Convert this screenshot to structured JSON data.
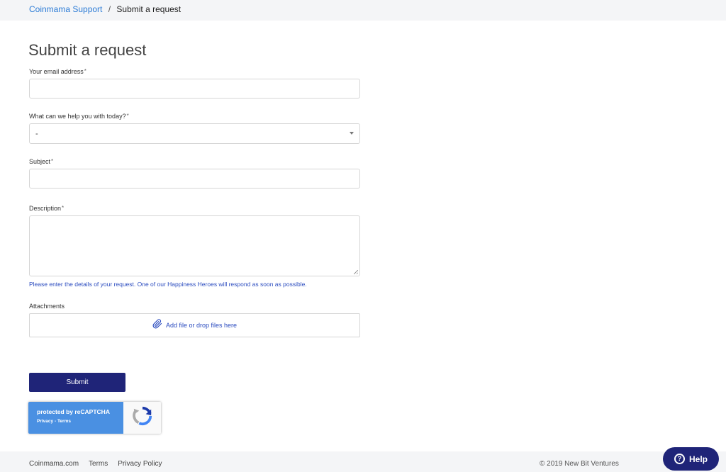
{
  "breadcrumb": {
    "home": "Coinmama Support",
    "separator": "/",
    "current": "Submit a request"
  },
  "page_title": "Submit a request",
  "form": {
    "email": {
      "label": "Your email address",
      "required_mark": "*",
      "value": ""
    },
    "topic": {
      "label": "What can we help you with today?",
      "required_mark": "*",
      "selected": "-"
    },
    "subject": {
      "label": "Subject",
      "required_mark": "*",
      "value": ""
    },
    "description": {
      "label": "Description",
      "required_mark": "*",
      "value": "",
      "hint": "Please enter the details of your request. One of our Happiness Heroes will respond as soon as possible."
    },
    "attachments": {
      "label": "Attachments",
      "dropzone_text": "Add file or drop files here",
      "icon": "paperclip-icon"
    },
    "submit_label": "Submit"
  },
  "recaptcha": {
    "title": "protected by reCAPTCHA",
    "privacy": "Privacy",
    "separator": "-",
    "terms": "Terms",
    "icon": "recaptcha-logo-icon"
  },
  "footer": {
    "links": [
      "Coinmama.com",
      "Terms",
      "Privacy Policy"
    ],
    "copyright": "© 2019 New Bit Ventures"
  },
  "help_widget": {
    "label": "Help",
    "icon": "question-circle-icon"
  },
  "colors": {
    "link": "#2b7bd6",
    "hint": "#2a4bbf",
    "primary_button": "#1f2478",
    "recaptcha_blue": "#4a90e2",
    "bar_background": "#f4f5f7"
  }
}
